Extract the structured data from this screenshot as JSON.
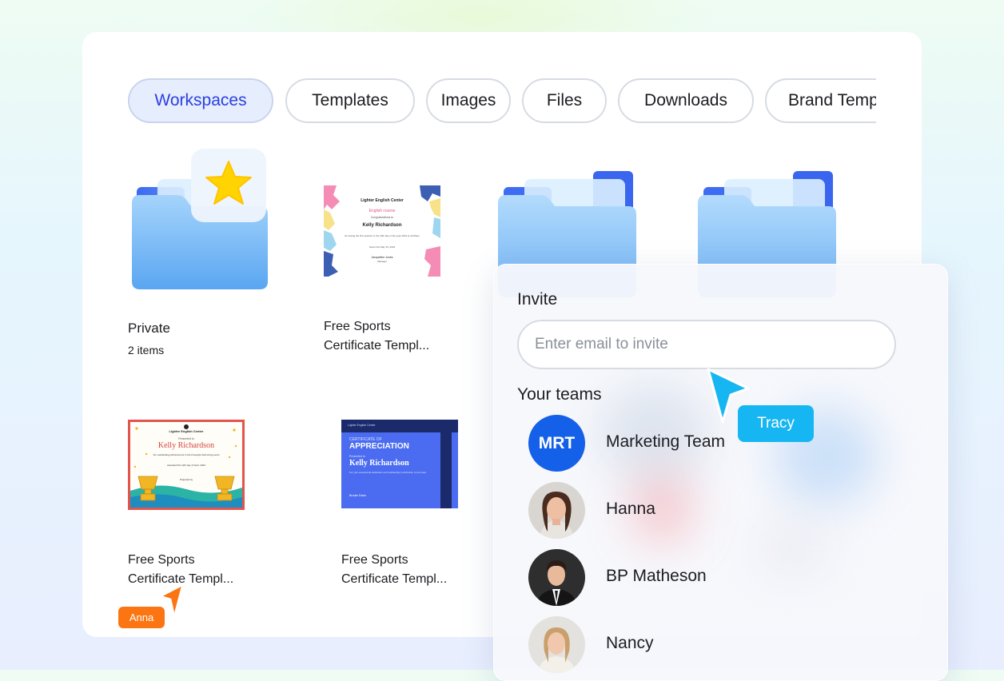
{
  "tabs": [
    {
      "label": "Workspaces",
      "active": true
    },
    {
      "label": "Templates",
      "active": false
    },
    {
      "label": "Images",
      "active": false
    },
    {
      "label": "Files",
      "active": false
    },
    {
      "label": "Downloads",
      "active": false
    },
    {
      "label": "Brand Templates",
      "active": false
    }
  ],
  "items": [
    {
      "title": "Private",
      "subtitle": "2 items",
      "kind": "starred-folder"
    },
    {
      "title_line1": "Free Sports",
      "title_line2": "Certificate Templ...",
      "kind": "certificate"
    },
    {
      "kind": "folder"
    },
    {
      "kind": "folder"
    },
    {
      "title_line1": "Free Sports",
      "title_line2": "Certificate Templ...",
      "kind": "certificate"
    },
    {
      "title_line1": "Free Sports",
      "title_line2": "Certificate Templ...",
      "kind": "certificate"
    }
  ],
  "cert1": {
    "org": "Lighter English Center",
    "course": "English course",
    "congrats": "Congratulations to",
    "name": "Kelly Richardson",
    "body": "for having the first position in the 10th day of the year 2024 at 12:00pm",
    "date": "Given this May 15, 2024",
    "signer": "Jacqueline Jones",
    "role": "Manager"
  },
  "cert2": {
    "org": "Lighter English Center",
    "presented": "Presented to",
    "name": "Kelly Richardson",
    "body": "For outstanding achievement in the Freestyle Swimming event",
    "date": "Awarded this 12th day of April, 2024",
    "prepared": "Prepared by"
  },
  "cert3": {
    "header": "Lighter English Center",
    "subtitle": "CERTIFICATE OF",
    "title": "APPRECIATION",
    "presented": "Presented to",
    "name": "Kelly Richardson",
    "body": "For your exceptional dedication and outstanding contribution to the team.",
    "signer": "Brooke Davis"
  },
  "invite": {
    "heading": "Invite",
    "placeholder": "Enter email to invite",
    "teams_heading": "Your teams",
    "members": [
      {
        "name": "Marketing Team",
        "initials": "MRT"
      },
      {
        "name": "Hanna"
      },
      {
        "name": "BP Matheson"
      },
      {
        "name": "Nancy"
      }
    ]
  },
  "cursors": {
    "tracy": {
      "label": "Tracy",
      "color": "#16b6f3"
    },
    "anna": {
      "label": "Anna",
      "color": "#fb7512"
    }
  },
  "colors": {
    "accent": "#2b3fe2",
    "active_tab_bg": "#e6edfd",
    "mrt_avatar": "#1560e8",
    "folder_blue": "#6bb0f5",
    "star": "#ffd400"
  }
}
